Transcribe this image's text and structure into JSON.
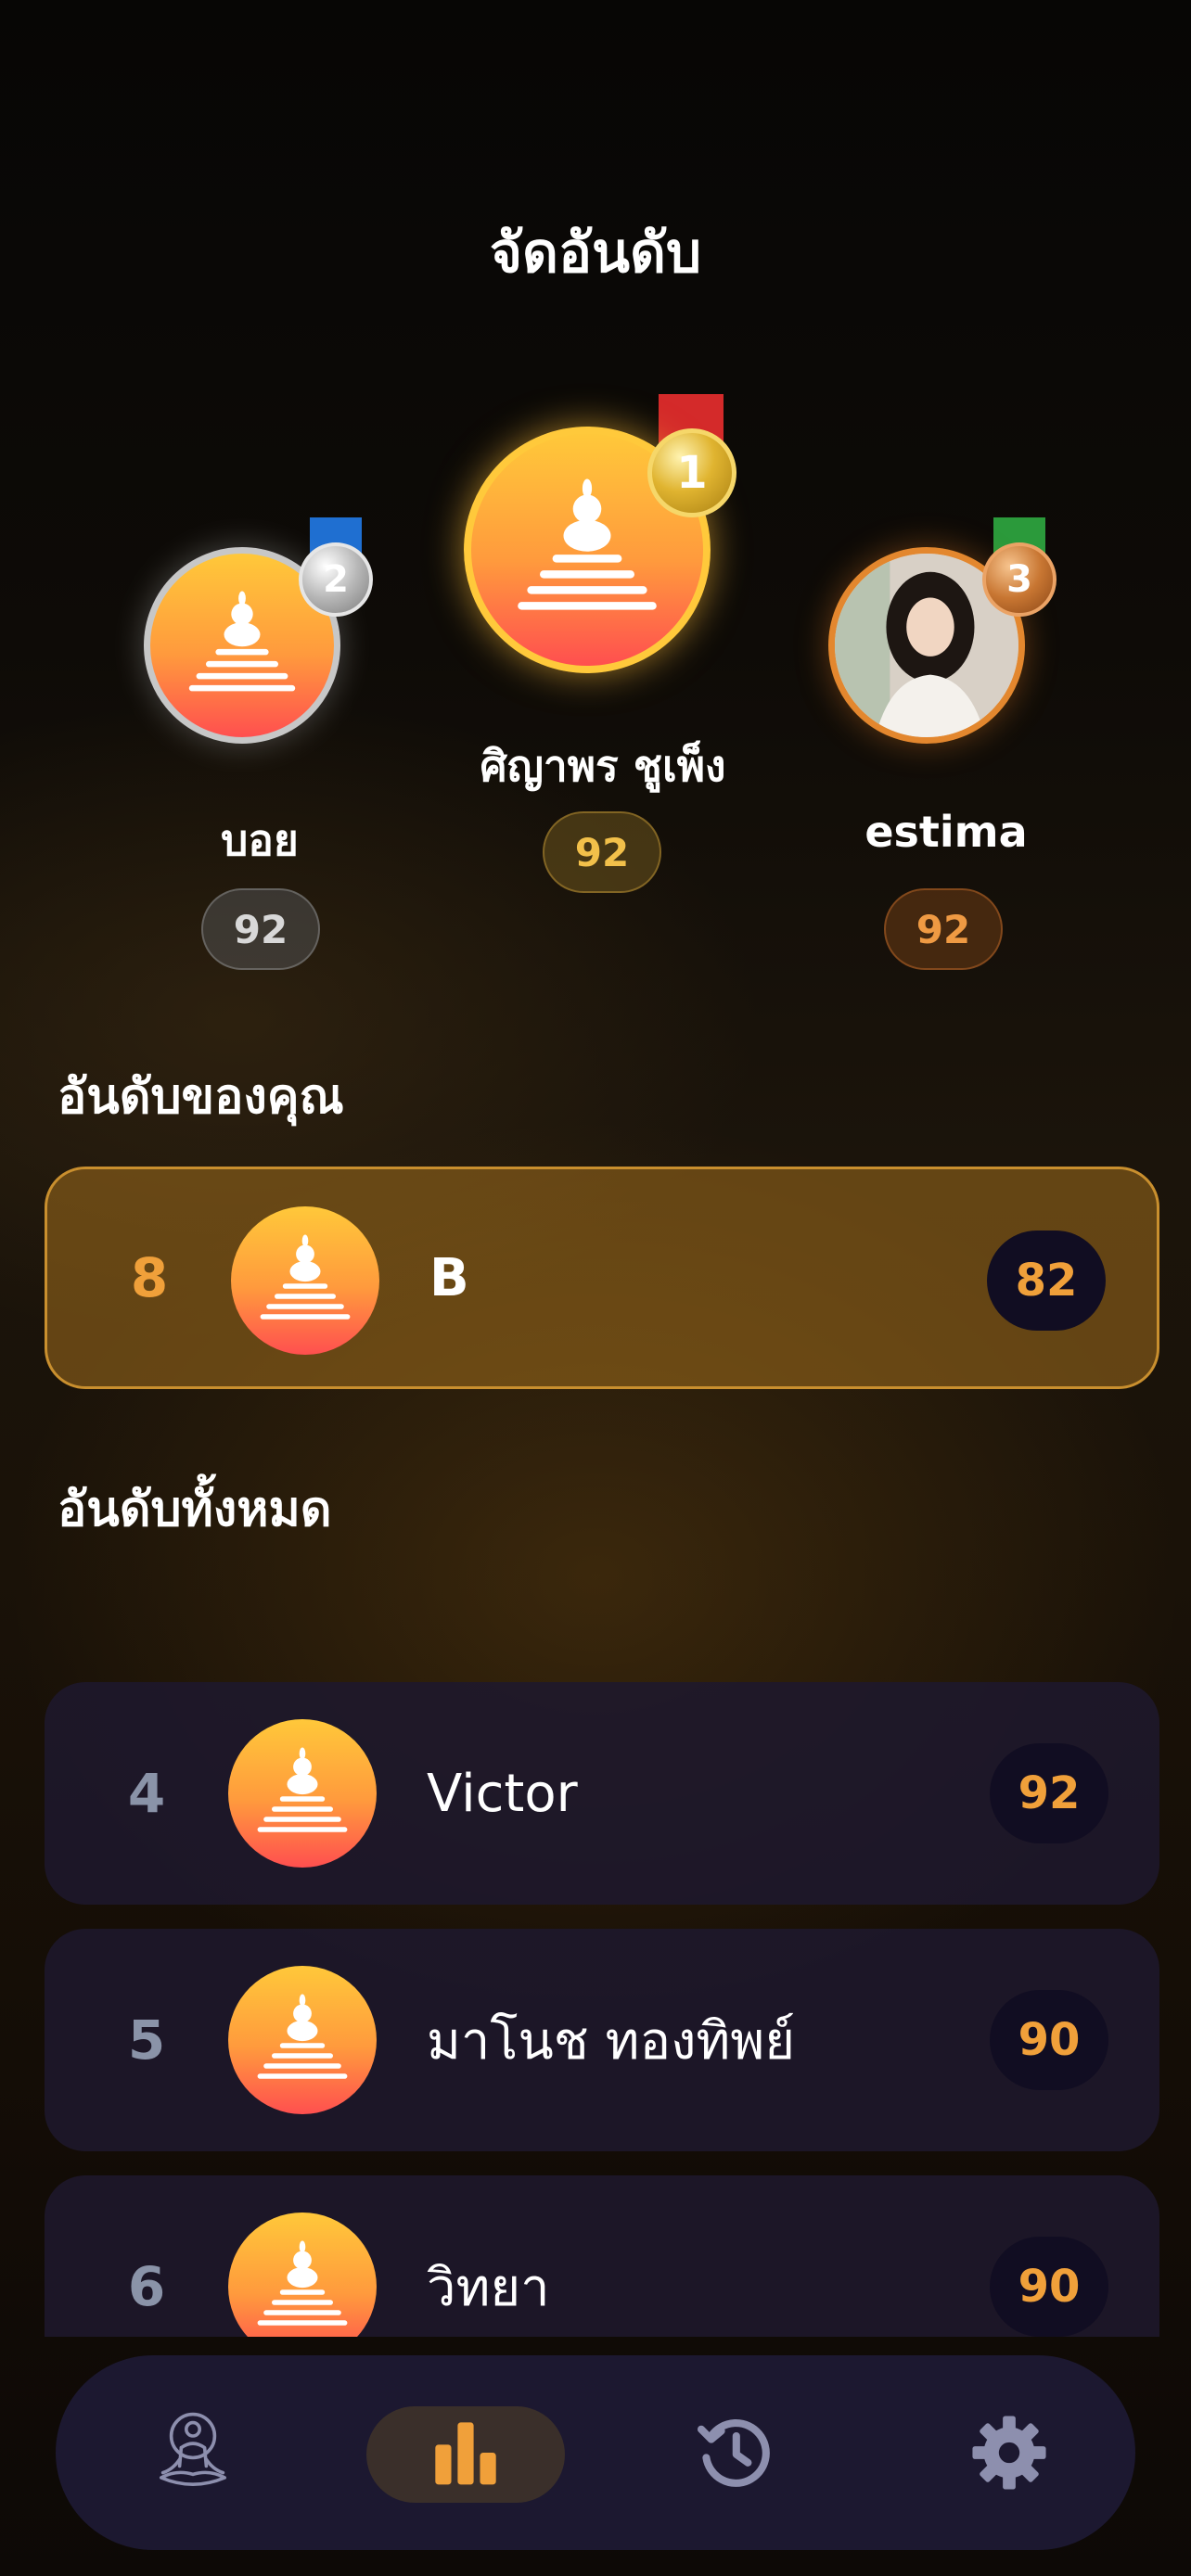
{
  "header": {
    "title": "จัดอันดับ"
  },
  "podium": {
    "first": {
      "rank": "1",
      "name": "ศิญาพร ชูเพ็ง",
      "score": "92"
    },
    "second": {
      "rank": "2",
      "name": "บอย",
      "score": "92"
    },
    "third": {
      "rank": "3",
      "name": "estima",
      "score": "92"
    }
  },
  "my_rank": {
    "section_title": "อันดับของคุณ",
    "rank": "8",
    "name": "B",
    "score": "82"
  },
  "all_ranks": {
    "section_title": "อันดับทั้งหมด",
    "rows": [
      {
        "rank": "4",
        "name": "Victor",
        "score": "92"
      },
      {
        "rank": "5",
        "name": "มาโนช ทองทิพย์",
        "score": "90"
      },
      {
        "rank": "6",
        "name": "วิทยา",
        "score": "90"
      }
    ]
  },
  "nav": {
    "items": [
      "meditation-icon",
      "leaderboard-icon",
      "history-icon",
      "settings-icon"
    ],
    "active": "leaderboard-icon"
  },
  "colors": {
    "accent": "#f0a03a",
    "gold": "#ffc93b",
    "silver": "#c7c7c7",
    "bronze": "#e3872e"
  }
}
